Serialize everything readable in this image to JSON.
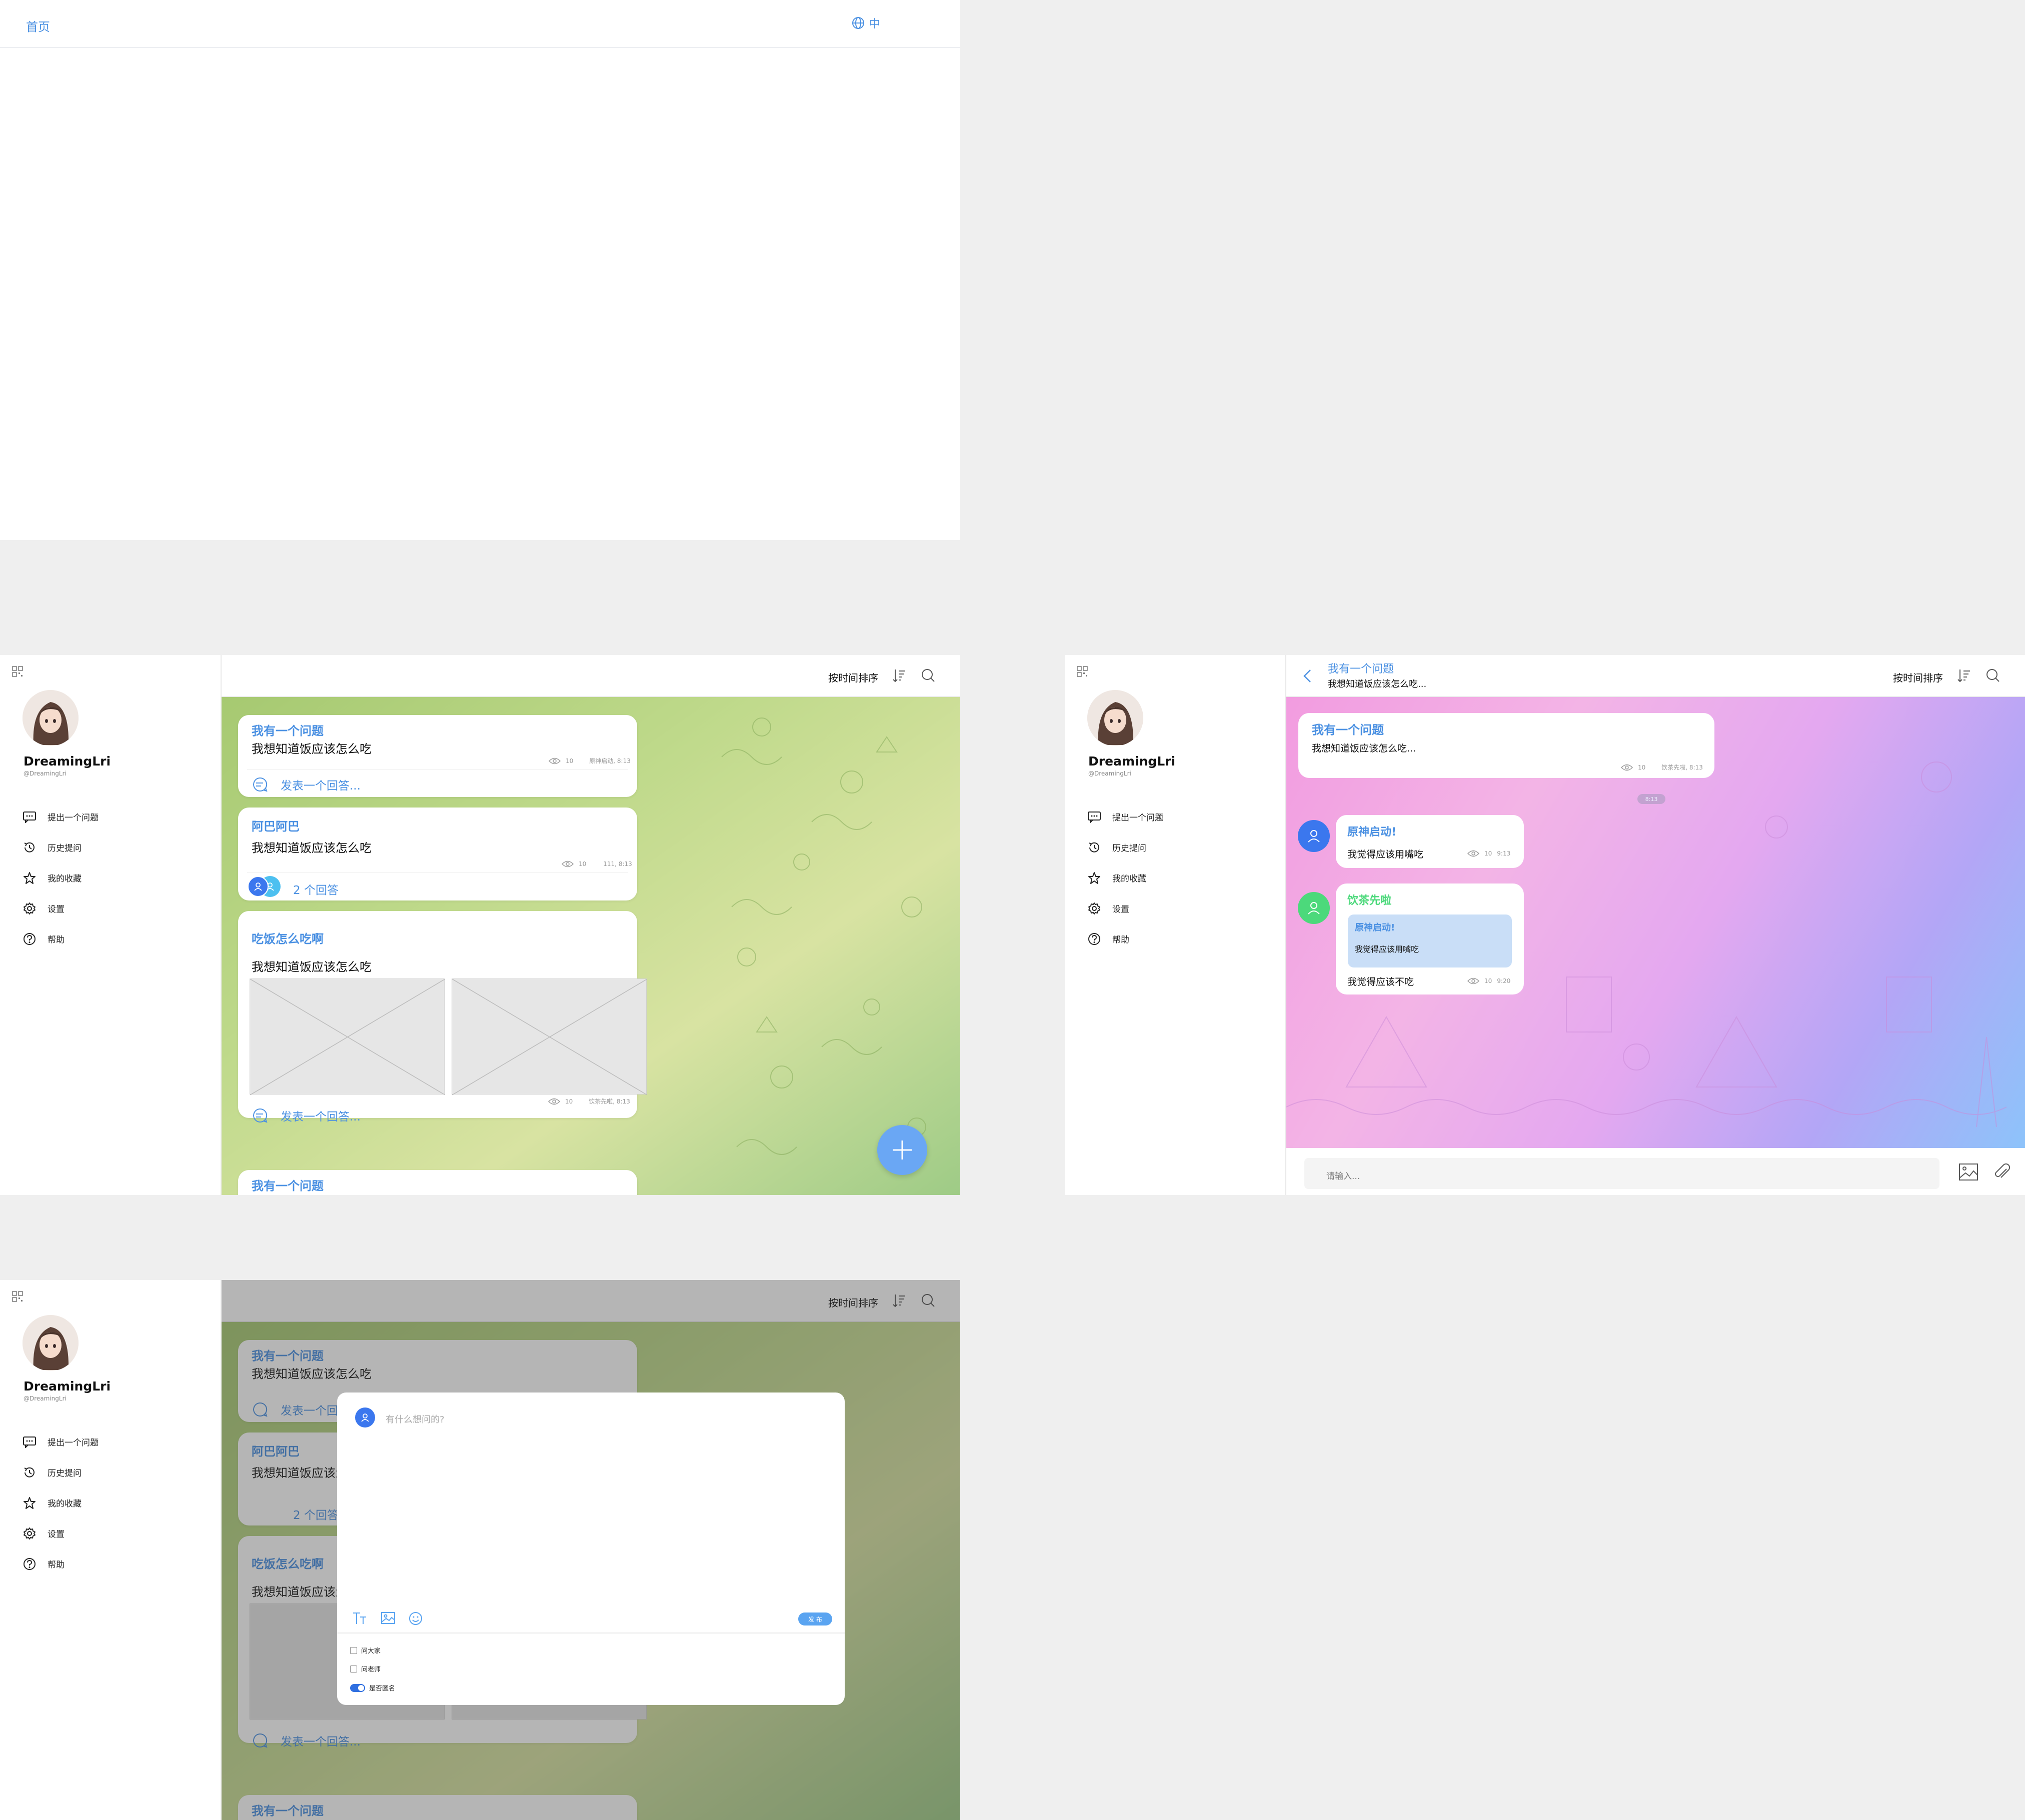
{
  "home": {
    "nav_home": "首页",
    "lang": "中"
  },
  "user": {
    "name": "DreamingLri",
    "handle": "@DreamingLri"
  },
  "menu": [
    {
      "label": "提出一个问题",
      "icon": "message-icon"
    },
    {
      "label": "历史提问",
      "icon": "history-icon"
    },
    {
      "label": "我的收藏",
      "icon": "star-icon"
    },
    {
      "label": "设置",
      "icon": "gear-icon"
    },
    {
      "label": "帮助",
      "icon": "help-icon"
    }
  ],
  "toolbar": {
    "sort_label": "按时间排序"
  },
  "feed": [
    {
      "title": "我有一个问题",
      "body": "我想知道饭应该怎么吃",
      "views": "10",
      "meta": "原神启动, 8:13",
      "reply": "发表一个回答..."
    },
    {
      "title": "阿巴阿巴",
      "body": "我想知道饭应该怎么吃",
      "views": "10",
      "meta": "111, 8:13",
      "answers": "2 个回答"
    },
    {
      "title": "吃饭怎么吃啊",
      "body": "我想知道饭应该怎么吃",
      "views": "10",
      "meta": "饮茶先啦, 8:13",
      "reply": "发表一个回答..."
    },
    {
      "title": "我有一个问题"
    }
  ],
  "thread": {
    "header_title": "我有一个问题",
    "header_sub": "我想知道饭应该怎么吃...",
    "question": {
      "title": "我有一个问题",
      "body": "我想知道饭应该怎么吃...",
      "views": "10",
      "meta": "饮茶先啦, 8:13"
    },
    "time_chip": "8:13",
    "answers": [
      {
        "author": "原神启动!",
        "body": "我觉得应该用嘴吃",
        "views": "10",
        "time": "9:13",
        "color": "#3b77ee"
      },
      {
        "author": "饮茶先啦",
        "quote_author": "原神启动!",
        "quote_body": "我觉得应该用嘴吃",
        "body": "我觉得应该不吃",
        "views": "10",
        "time": "9:20",
        "color": "#4cd97b"
      }
    ],
    "input_placeholder": "请输入..."
  },
  "modal": {
    "placeholder": "有什么想问的?",
    "publish": "发 布",
    "options": [
      {
        "label": "问大家",
        "checked": false
      },
      {
        "label": "问老师",
        "checked": false
      },
      {
        "label": "是否匿名",
        "toggle": true,
        "on": true
      }
    ]
  },
  "colors": {
    "accent": "#4a90e2",
    "fab": "#6aa7f4",
    "green_author": "#4cd97b"
  }
}
